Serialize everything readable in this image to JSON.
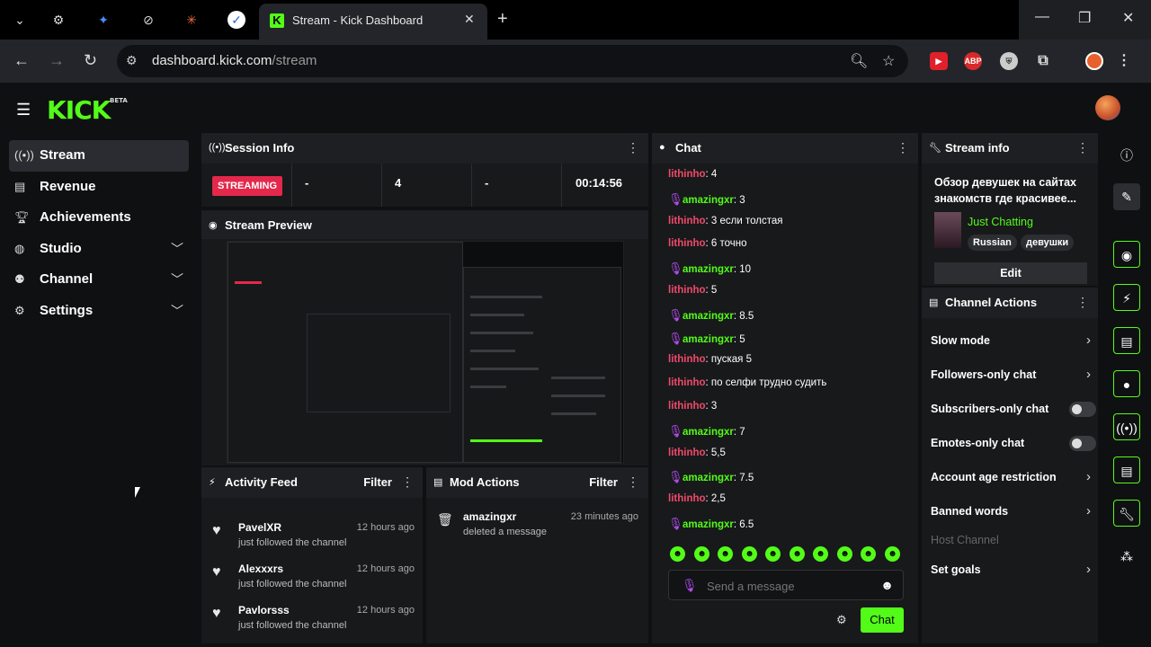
{
  "browser": {
    "tab_title": "Stream - Kick Dashboard",
    "url_host": "dashboard.kick.com",
    "url_path": "/stream"
  },
  "app": {
    "logo": "KICK",
    "logo_beta": "BETA"
  },
  "sidebar": {
    "items": [
      {
        "label": "Stream",
        "icon": "broadcast-icon",
        "active": true,
        "has_chevron": false
      },
      {
        "label": "Revenue",
        "icon": "chart-icon",
        "active": false,
        "has_chevron": false
      },
      {
        "label": "Achievements",
        "icon": "trophy-icon",
        "active": false,
        "has_chevron": false
      },
      {
        "label": "Studio",
        "icon": "palette-icon",
        "active": false,
        "has_chevron": true
      },
      {
        "label": "Channel",
        "icon": "users-icon",
        "active": false,
        "has_chevron": true
      },
      {
        "label": "Settings",
        "icon": "gear-icon",
        "active": false,
        "has_chevron": true
      }
    ]
  },
  "session": {
    "title": "Session Info",
    "status": "STREAMING",
    "viewers": "-",
    "followers": "4",
    "subs": "-",
    "time": "00:14:56"
  },
  "preview": {
    "title": "Stream Preview"
  },
  "activity": {
    "title": "Activity Feed",
    "filter": "Filter",
    "items": [
      {
        "name": "PavelXR",
        "sub": "just followed the channel",
        "time": "12 hours ago"
      },
      {
        "name": "Alexxxrs",
        "sub": "just followed the channel",
        "time": "12 hours ago"
      },
      {
        "name": "Pavlorsss",
        "sub": "just followed the channel",
        "time": "12 hours ago"
      }
    ]
  },
  "mod": {
    "title": "Mod Actions",
    "filter": "Filter",
    "items": [
      {
        "name": "amazingxr",
        "sub": "deleted a message",
        "time": "23 minutes ago"
      }
    ]
  },
  "chat": {
    "title": "Chat",
    "placeholder": "Send a message",
    "send": "Chat",
    "messages": [
      {
        "user": "lithinho",
        "text": "4",
        "kind": "u1"
      },
      {
        "user": "amazingxr",
        "text": "3",
        "kind": "u2"
      },
      {
        "user": "lithinho",
        "text": "3 если толстая",
        "kind": "u1"
      },
      {
        "user": "lithinho",
        "text": "6 точно",
        "kind": "u1"
      },
      {
        "user": "amazingxr",
        "text": "10",
        "kind": "u2"
      },
      {
        "user": "lithinho",
        "text": "5",
        "kind": "u1"
      },
      {
        "user": "amazingxr",
        "text": "8.5",
        "kind": "u2"
      },
      {
        "user": "amazingxr",
        "text": "5",
        "kind": "u2"
      },
      {
        "user": "lithinho",
        "text": "пуская 5",
        "kind": "u1"
      },
      {
        "user": "lithinho",
        "text": "по селфи трудно судить",
        "kind": "u1"
      },
      {
        "user": "lithinho",
        "text": "3",
        "kind": "u1"
      },
      {
        "user": "amazingxr",
        "text": "7",
        "kind": "u2"
      },
      {
        "user": "lithinho",
        "text": "5,5",
        "kind": "u1"
      },
      {
        "user": "amazingxr",
        "text": "7.5",
        "kind": "u2"
      },
      {
        "user": "lithinho",
        "text": "2,5",
        "kind": "u1"
      },
      {
        "user": "amazingxr",
        "text": "6.5",
        "kind": "u2"
      }
    ]
  },
  "stream_info": {
    "title": "Stream info",
    "stream_title": "Обзор девушек на сайтах знакомств где красивее...",
    "category": "Just Chatting",
    "tags": [
      "Russian",
      "девушки"
    ],
    "edit": "Edit"
  },
  "channel_actions": {
    "title": "Channel Actions",
    "items": [
      {
        "label": "Slow mode",
        "type": "arrow"
      },
      {
        "label": "Followers-only chat",
        "type": "arrow"
      },
      {
        "label": "Subscribers-only chat",
        "type": "toggle"
      },
      {
        "label": "Emotes-only chat",
        "type": "toggle"
      },
      {
        "label": "Account age restriction",
        "type": "arrow"
      },
      {
        "label": "Banned words",
        "type": "arrow"
      },
      {
        "label": "Host Channel",
        "type": "disabled"
      },
      {
        "label": "Set goals",
        "type": "arrow"
      }
    ]
  },
  "colors": {
    "accent": "#53fc18",
    "live": "#e3284b"
  }
}
